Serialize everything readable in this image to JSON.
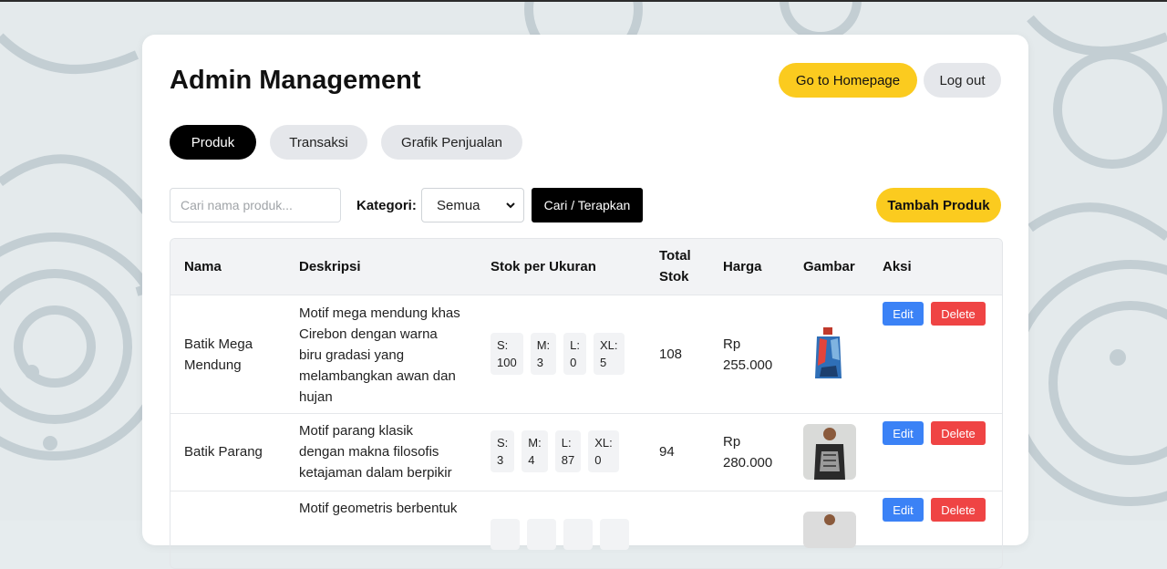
{
  "header": {
    "title": "Admin Management",
    "home_label": "Go to Homepage",
    "logout_label": "Log out"
  },
  "tabs": [
    {
      "label": "Produk",
      "active": true
    },
    {
      "label": "Transaksi",
      "active": false
    },
    {
      "label": "Grafik Penjualan",
      "active": false
    }
  ],
  "filters": {
    "search_placeholder": "Cari nama produk...",
    "kategori_label": "Kategori:",
    "kategori_selected": "Semua",
    "apply_label": "Cari / Terapkan",
    "add_label": "Tambah Produk"
  },
  "table": {
    "headers": {
      "nama": "Nama",
      "deskripsi": "Deskripsi",
      "stok": "Stok per Ukuran",
      "total_1": "Total",
      "total_2": "Stok",
      "harga": "Harga",
      "gambar": "Gambar",
      "aksi": "Aksi"
    },
    "rows": [
      {
        "nama_1": "Batik Mega",
        "nama_2": "Mendung",
        "desc": [
          "Motif mega mendung khas",
          "Cirebon dengan warna",
          "biru gradasi yang",
          "melambangkan awan dan",
          "hujan"
        ],
        "sizes": [
          {
            "label": "S:",
            "qty": "100"
          },
          {
            "label": "M:",
            "qty": "3"
          },
          {
            "label": "L:",
            "qty": "0"
          },
          {
            "label": "XL:",
            "qty": "5"
          }
        ],
        "total": "108",
        "harga_1": "Rp",
        "harga_2": "255.000"
      },
      {
        "nama_1": "Batik Parang",
        "desc": [
          "Motif parang klasik",
          "dengan makna filosofis",
          "ketajaman dalam berpikir"
        ],
        "sizes": [
          {
            "label": "S:",
            "qty": "3"
          },
          {
            "label": "M:",
            "qty": "4"
          },
          {
            "label": "L:",
            "qty": "87"
          },
          {
            "label": "XL:",
            "qty": "0"
          }
        ],
        "total": "94",
        "harga_1": "Rp",
        "harga_2": "280.000"
      },
      {
        "desc": [
          "Motif geometris berbentuk"
        ]
      }
    ],
    "edit_label": "Edit",
    "delete_label": "Delete"
  },
  "colors": {
    "accent": "#fbcb1f",
    "edit": "#3b82f6",
    "delete": "#ef4444",
    "active_tab": "#000000"
  },
  "icons": {
    "select_arrow": "chevron-down-icon"
  }
}
